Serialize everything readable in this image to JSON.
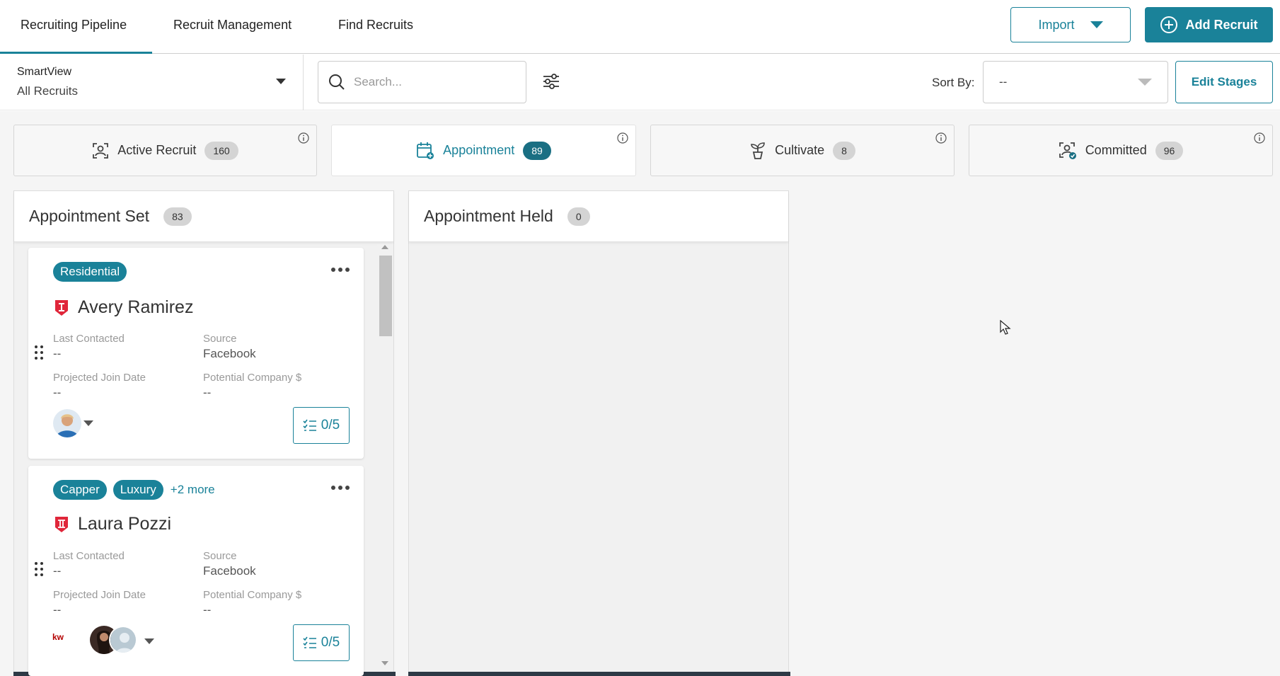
{
  "nav": {
    "tabs": [
      {
        "label": "Recruiting Pipeline"
      },
      {
        "label": "Recruit Management"
      },
      {
        "label": "Find Recruits"
      }
    ],
    "import_label": "Import",
    "add_label": "Add Recruit"
  },
  "filters": {
    "smartview_title": "SmartView",
    "smartview_value": "All Recruits",
    "search_placeholder": "Search...",
    "sort_label": "Sort By:",
    "sort_value": "--",
    "edit_stages_label": "Edit Stages"
  },
  "stages": [
    {
      "label": "Active Recruit",
      "count": "160",
      "icon": "person-scan-icon"
    },
    {
      "label": "Appointment",
      "count": "89",
      "icon": "calendar-add-icon"
    },
    {
      "label": "Cultivate",
      "count": "8",
      "icon": "plant-icon"
    },
    {
      "label": "Committed",
      "count": "96",
      "icon": "person-check-icon"
    }
  ],
  "columns": [
    {
      "title": "Appointment Set",
      "count": "83"
    },
    {
      "title": "Appointment Held",
      "count": "0"
    }
  ],
  "cards": [
    {
      "tags": [
        "Residential"
      ],
      "more": "",
      "name": "Avery Ramirez",
      "last_contacted_label": "Last Contacted",
      "last_contacted": "--",
      "source_label": "Source",
      "source": "Facebook",
      "join_label": "Projected Join Date",
      "join": "--",
      "company_label": "Potential Company $",
      "company": "--",
      "checklist": "0/5"
    },
    {
      "tags": [
        "Capper",
        "Luxury"
      ],
      "more": "+2 more",
      "name": "Laura Pozzi",
      "last_contacted_label": "Last Contacted",
      "last_contacted": "--",
      "source_label": "Source",
      "source": "Facebook",
      "join_label": "Projected Join Date",
      "join": "--",
      "company_label": "Potential Company $",
      "company": "--",
      "checklist": "0/5",
      "logo_text": "kw"
    }
  ],
  "colors": {
    "accent": "#1a8299",
    "badge_red": "#e0263a",
    "dark_bar": "#2e3a46"
  }
}
